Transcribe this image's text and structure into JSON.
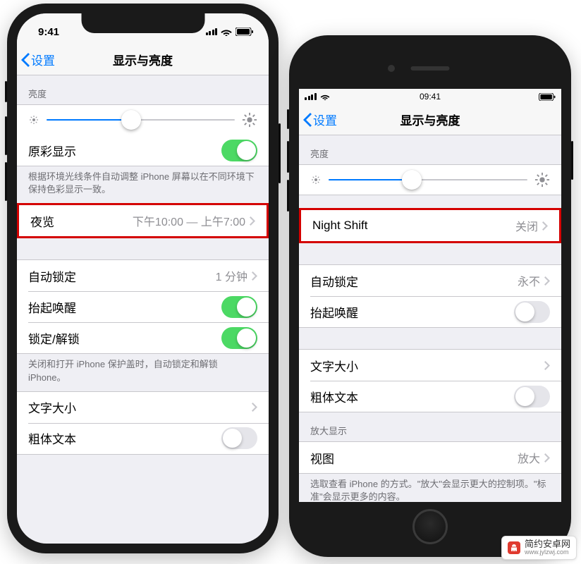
{
  "watermark": {
    "name": "简约安卓网",
    "url": "www.jylzwj.com"
  },
  "phone_left": {
    "status": {
      "time": "9:41"
    },
    "nav": {
      "back": "设置",
      "title": "显示与亮度"
    },
    "brightness": {
      "header": "亮度",
      "slider_pct": 45
    },
    "true_tone": {
      "label": "原彩显示",
      "on": true
    },
    "true_tone_footer": "根据环境光线条件自动调整 iPhone 屏幕以在不同环境下保持色彩显示一致。",
    "night_shift": {
      "label": "夜览",
      "detail": "下午10:00 — 上午7:00"
    },
    "auto_lock": {
      "label": "自动锁定",
      "detail": "1 分钟"
    },
    "raise_to_wake": {
      "label": "抬起唤醒",
      "on": true
    },
    "lock_unlock": {
      "label": "锁定/解锁",
      "on": true
    },
    "lock_footer": "关闭和打开 iPhone 保护盖时，自动锁定和解锁 iPhone。",
    "text_size": {
      "label": "文字大小"
    },
    "bold_text": {
      "label": "粗体文本",
      "on": false
    }
  },
  "phone_right": {
    "status": {
      "time": "09:41"
    },
    "nav": {
      "back": "设置",
      "title": "显示与亮度"
    },
    "brightness": {
      "header": "亮度",
      "slider_pct": 42
    },
    "night_shift": {
      "label": "Night Shift",
      "detail": "关闭"
    },
    "auto_lock": {
      "label": "自动锁定",
      "detail": "永不"
    },
    "raise_to_wake": {
      "label": "抬起唤醒",
      "on": false
    },
    "text_size": {
      "label": "文字大小"
    },
    "bold_text": {
      "label": "粗体文本",
      "on": false
    },
    "zoom_header": "放大显示",
    "zoom_view": {
      "label": "视图",
      "detail": "放大"
    },
    "zoom_footer": "选取查看 iPhone 的方式。\"放大\"会显示更大的控制项。\"标准\"会显示更多的内容。"
  }
}
